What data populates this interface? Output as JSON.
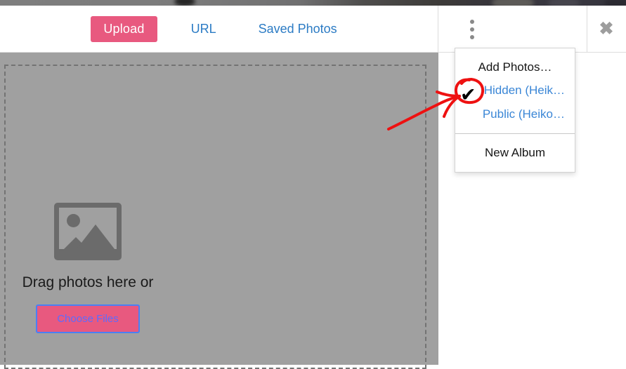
{
  "window": {
    "type": "photo-upload-modal"
  },
  "header": {
    "upload_label": "Upload",
    "url_label": "URL",
    "saved_photos_label": "Saved Photos",
    "kebab_icon": "three-dots-vertical-icon",
    "close_icon": "close-x-icon",
    "close_glyph": "✖",
    "accent_pink": "#e8597f",
    "link_blue": "#2b7bc4"
  },
  "dropzone": {
    "image_icon": "photo-placeholder-icon",
    "drag_text": "Drag photos here or",
    "choose_files_label": "Choose Files",
    "background_color": "#a0a0a0",
    "border_style": "dashed"
  },
  "dropdown": {
    "sections": [
      {
        "items": [
          {
            "label": "Add Photos…",
            "style": "dark",
            "checked": false
          },
          {
            "label": "Hidden (Heik…",
            "style": "link",
            "checked": true
          },
          {
            "label": "Public (Heiko…",
            "style": "link",
            "checked": false
          }
        ]
      },
      {
        "items": [
          {
            "label": "New Album",
            "style": "dark",
            "checked": false
          }
        ]
      }
    ],
    "check_glyph": "✔"
  },
  "annotation": {
    "type": "hand-drawn-arrow-and-circle",
    "color": "#ee1111",
    "target": "Hidden (Heik… checkmark"
  }
}
